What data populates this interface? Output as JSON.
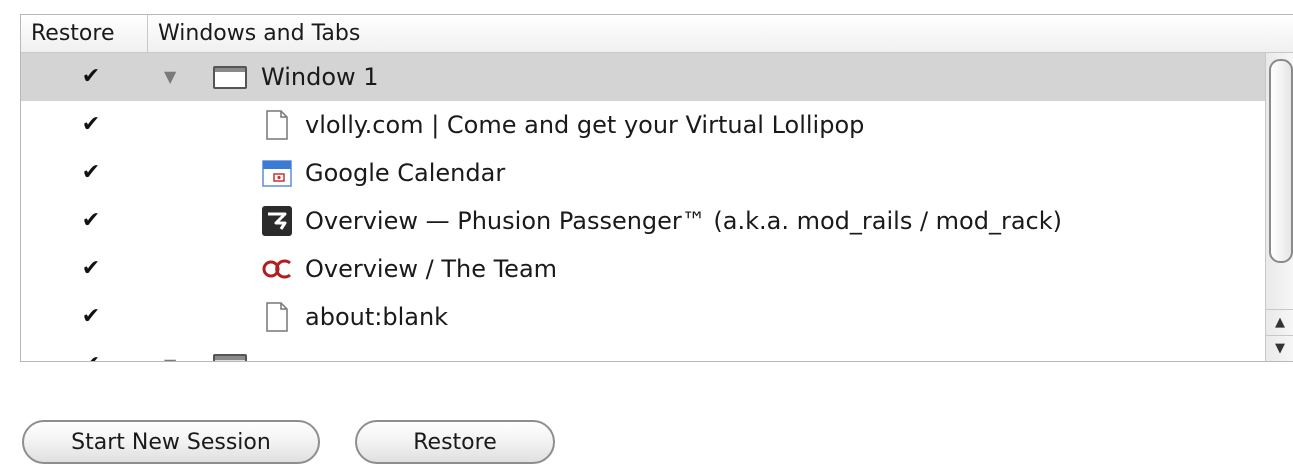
{
  "table": {
    "headers": {
      "restore": "Restore",
      "windows_and_tabs": "Windows and Tabs"
    },
    "window1": {
      "label": "Window 1",
      "checked": true,
      "expanded": true
    },
    "tabs": [
      {
        "label": "vlolly.com | Come and get your Virtual Lollipop",
        "icon": "document-icon",
        "checked": true
      },
      {
        "label": "Google Calendar",
        "icon": "google-calendar-icon",
        "checked": true
      },
      {
        "label": "Overview — Phusion Passenger™ (a.k.a. mod_rails / mod_rack)",
        "icon": "phusion-passenger-icon",
        "checked": true
      },
      {
        "label": "Overview / The Team",
        "icon": "oc-logo-icon",
        "checked": true
      },
      {
        "label": "about:blank",
        "icon": "document-icon",
        "checked": true
      }
    ],
    "check_glyph": "✔",
    "disclosure_glyph": "▼"
  },
  "scrollbar": {
    "up_arrow": "▲",
    "down_arrow": "▼"
  },
  "buttons": {
    "start_new_session": "Start New Session",
    "restore": "Restore"
  },
  "colors": {
    "selected_row": "#d4d4d4",
    "calendar_blue": "#3b7bd6",
    "oc_red": "#b01e1e"
  }
}
